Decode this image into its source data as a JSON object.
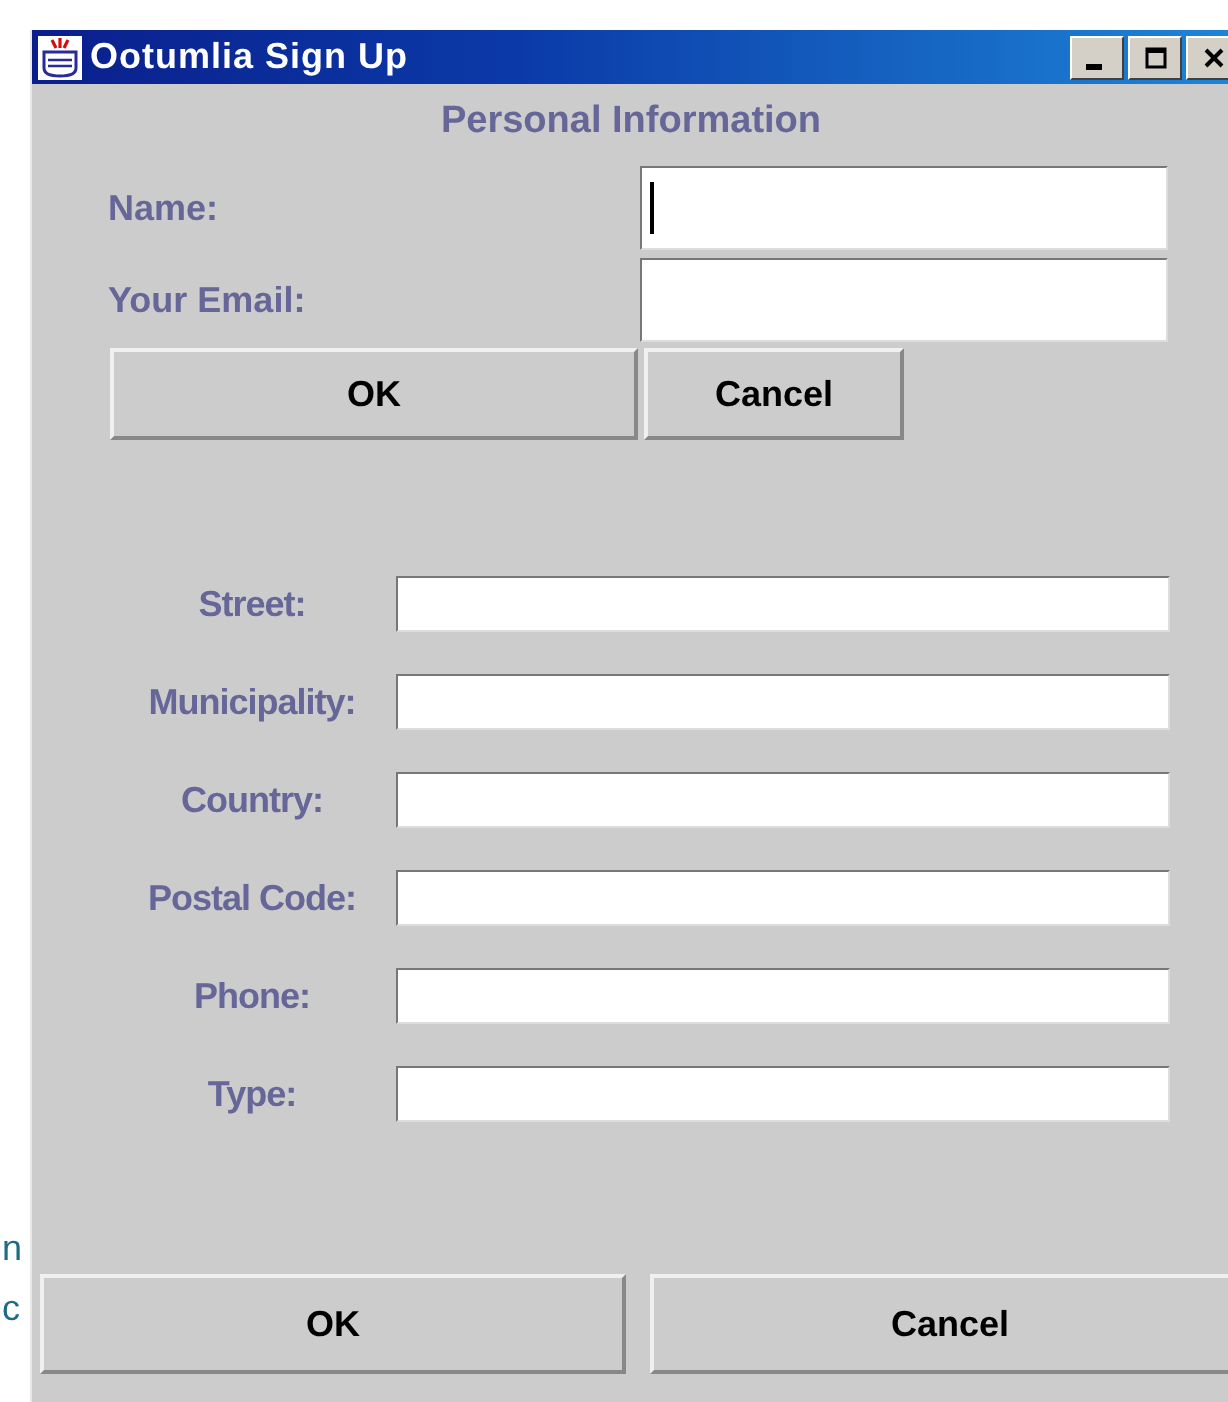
{
  "background_text": [
    "n",
    "c"
  ],
  "window": {
    "title": "Ootumlia Sign Up"
  },
  "heading": "Personal Information",
  "personal_fields": [
    {
      "label": "Name:",
      "focused": true
    },
    {
      "label": "Your Email:",
      "focused": false
    }
  ],
  "personal_buttons": [
    "OK",
    "Cancel"
  ],
  "address_fields": [
    {
      "label": "Street:"
    },
    {
      "label": "Municipality:"
    },
    {
      "label": "Country:"
    },
    {
      "label": "Postal Code:"
    },
    {
      "label": "Phone:"
    },
    {
      "label": "Type:"
    }
  ],
  "bottom_buttons": [
    "OK",
    "Cancel"
  ]
}
